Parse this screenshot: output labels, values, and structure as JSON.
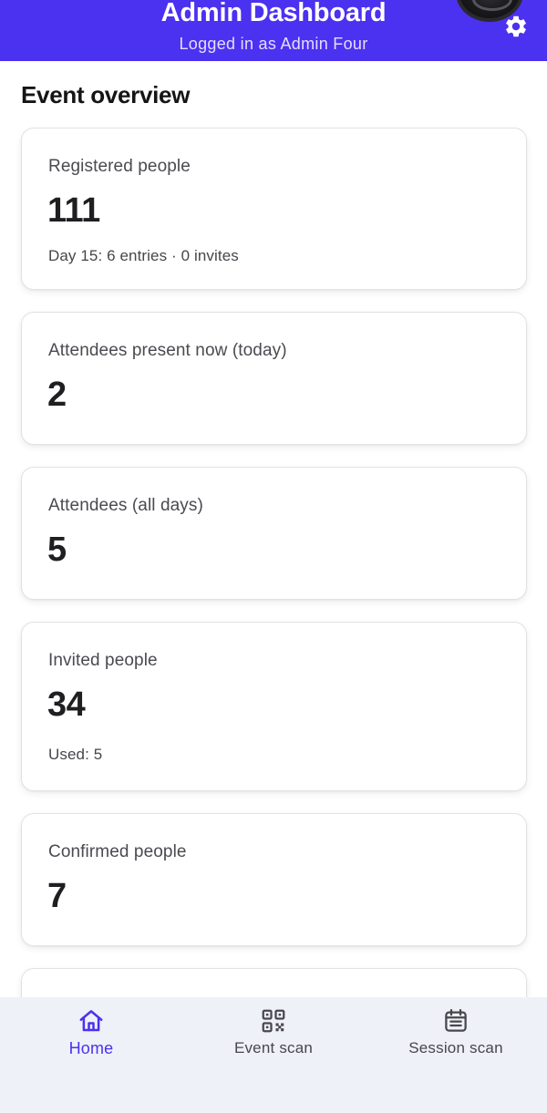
{
  "header": {
    "title": "Admin Dashboard",
    "subtitle": "Logged in as Admin Four"
  },
  "overview": {
    "title": "Event overview",
    "cards": [
      {
        "label": "Registered people",
        "value": "111",
        "note": "Day 15: 6 entries · 0 invites"
      },
      {
        "label": "Attendees present now (today)",
        "value": "2"
      },
      {
        "label": "Attendees (all days)",
        "value": "5"
      },
      {
        "label": "Invited people",
        "value": "34",
        "note": "Used: 5"
      },
      {
        "label": "Confirmed people",
        "value": "7"
      }
    ]
  },
  "nav": {
    "items": [
      {
        "label": "Home",
        "icon": "home-icon",
        "active": true
      },
      {
        "label": "Event scan",
        "icon": "qr-code-icon",
        "active": false
      },
      {
        "label": "Session scan",
        "icon": "calendar-list-icon",
        "active": false
      }
    ]
  },
  "colors": {
    "primary": "#4b31f0",
    "nav_background": "#eef1f7"
  }
}
